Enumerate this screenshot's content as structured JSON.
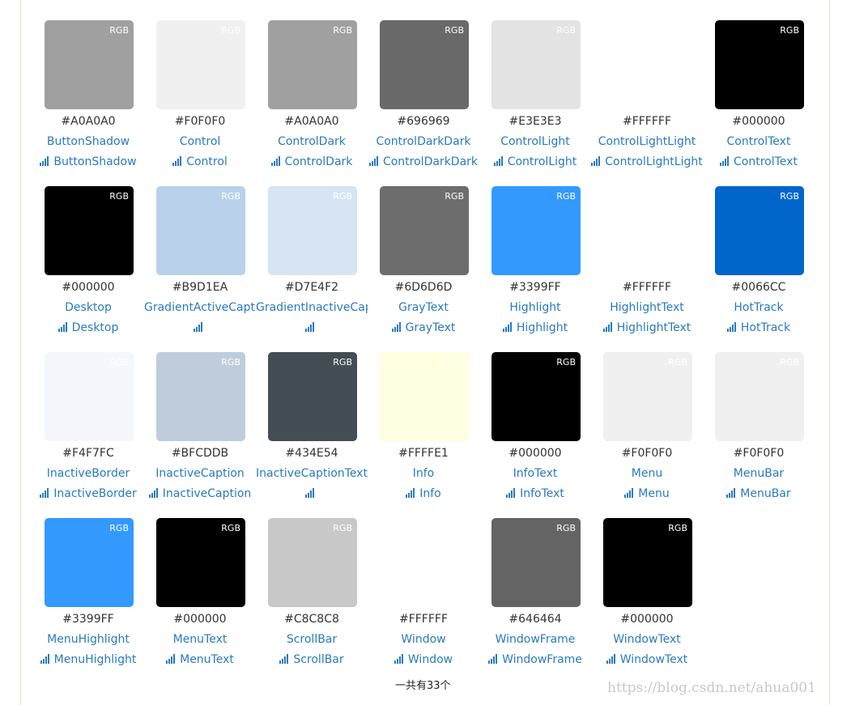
{
  "rgb_label": "RGB",
  "colors": [
    {
      "hex": "#A0A0A0",
      "name": "ButtonShadow",
      "link": "ButtonShadow"
    },
    {
      "hex": "#F0F0F0",
      "name": "Control",
      "link": "Control"
    },
    {
      "hex": "#A0A0A0",
      "name": "ControlDark",
      "link": "ControlDark"
    },
    {
      "hex": "#696969",
      "name": "ControlDarkDark",
      "link": "ControlDarkDark"
    },
    {
      "hex": "#E3E3E3",
      "name": "ControlLight",
      "link": "ControlLight"
    },
    {
      "hex": "#FFFFFF",
      "name": "ControlLightLight",
      "link": "ControlLightLight"
    },
    {
      "hex": "#000000",
      "name": "ControlText",
      "link": "ControlText"
    },
    {
      "hex": "#000000",
      "name": "Desktop",
      "link": "Desktop"
    },
    {
      "hex": "#B9D1EA",
      "name": "GradientActiveCaption",
      "link": ""
    },
    {
      "hex": "#D7E4F2",
      "name": "GradientInactiveCaption",
      "link": ""
    },
    {
      "hex": "#6D6D6D",
      "name": "GrayText",
      "link": "GrayText"
    },
    {
      "hex": "#3399FF",
      "name": "Highlight",
      "link": "Highlight"
    },
    {
      "hex": "#FFFFFF",
      "name": "HighlightText",
      "link": "HighlightText"
    },
    {
      "hex": "#0066CC",
      "name": "HotTrack",
      "link": "HotTrack"
    },
    {
      "hex": "#F4F7FC",
      "name": "InactiveBorder",
      "link": "InactiveBorder"
    },
    {
      "hex": "#BFCDDB",
      "name": "InactiveCaption",
      "link": "InactiveCaption"
    },
    {
      "hex": "#434E54",
      "name": "InactiveCaptionText",
      "link": ""
    },
    {
      "hex": "#FFFFE1",
      "name": "Info",
      "link": "Info"
    },
    {
      "hex": "#000000",
      "name": "InfoText",
      "link": "InfoText"
    },
    {
      "hex": "#F0F0F0",
      "name": "Menu",
      "link": "Menu"
    },
    {
      "hex": "#F0F0F0",
      "name": "MenuBar",
      "link": "MenuBar"
    },
    {
      "hex": "#3399FF",
      "name": "MenuHighlight",
      "link": "MenuHighlight"
    },
    {
      "hex": "#000000",
      "name": "MenuText",
      "link": "MenuText"
    },
    {
      "hex": "#C8C8C8",
      "name": "ScrollBar",
      "link": "ScrollBar"
    },
    {
      "hex": "#FFFFFF",
      "name": "Window",
      "link": "Window"
    },
    {
      "hex": "#646464",
      "name": "WindowFrame",
      "link": "WindowFrame"
    },
    {
      "hex": "#000000",
      "name": "WindowText",
      "link": "WindowText"
    }
  ],
  "total": "一共有33个",
  "watermark": "https://blog.csdn.net/ahua001"
}
